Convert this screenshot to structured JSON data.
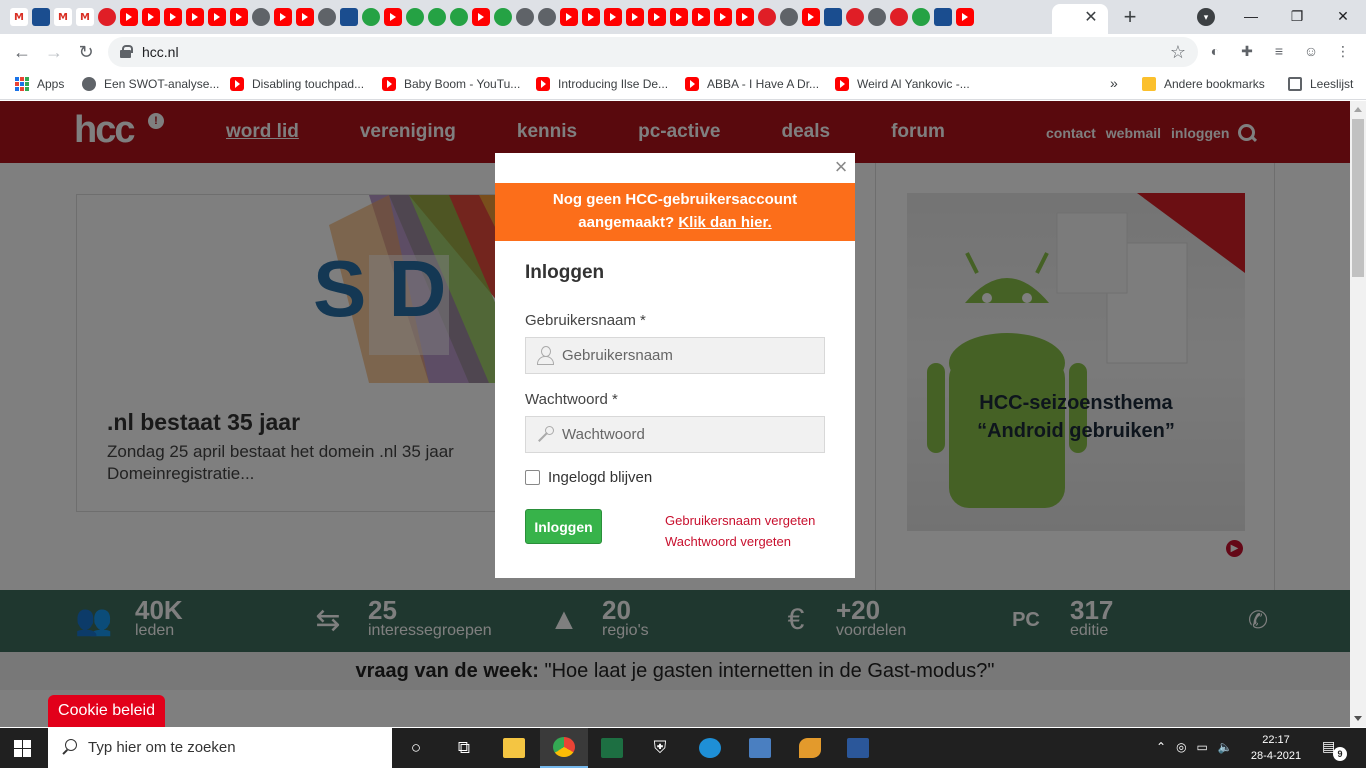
{
  "browser": {
    "url": "hcc.nl",
    "bookmarks": [
      {
        "label": "Apps",
        "icon": "apps-icon"
      },
      {
        "label": "Een SWOT-analyse...",
        "icon": "globe-icon"
      },
      {
        "label": "Disabling touchpad...",
        "icon": "youtube-icon"
      },
      {
        "label": "Baby Boom - YouTu...",
        "icon": "youtube-icon"
      },
      {
        "label": "Introducing Ilse De...",
        "icon": "youtube-icon"
      },
      {
        "label": "ABBA - I Have A Dr...",
        "icon": "youtube-icon"
      },
      {
        "label": "Weird Al Yankovic -...",
        "icon": "youtube-icon"
      }
    ],
    "bookmarks_more": "»",
    "other_bookmarks": "Andere bookmarks",
    "reading_list": "Leeslijst"
  },
  "site": {
    "logo": "hcc",
    "logo_mark": "!",
    "nav": [
      "word lid",
      "vereniging",
      "kennis",
      "pc-active",
      "deals",
      "forum"
    ],
    "side_nav": [
      "contact",
      "webmail",
      "inloggen"
    ],
    "news": {
      "image_text": "S D",
      "title": ".nl bestaat 35 jaar",
      "text": "Zondag 25 april bestaat het domein .nl 35 jaar Domeinregistratie...",
      "ghost": "Zo... ...g"
    },
    "feature": {
      "line1": "HCC-seizoensthema",
      "line2": "“Android gebruiken”"
    },
    "stats": [
      {
        "num": "40K",
        "label": "leden",
        "icon": "people-icon"
      },
      {
        "num": "25",
        "label": "interessegroepen",
        "icon": "signpost-icon"
      },
      {
        "num": "20",
        "label": "regio's",
        "icon": "netherlands-map-icon"
      },
      {
        "num": "+20",
        "label": "voordelen",
        "icon": "euro-badge-icon"
      },
      {
        "num": "317",
        "label": "editie",
        "icon": "pc-active-icon"
      }
    ],
    "question_label": "vraag van de week:",
    "question_text": "\"Hoe laat je gasten internetten in de Gast-modus?\"",
    "cookie": "Cookie beleid"
  },
  "modal": {
    "banner_line1": "Nog geen HCC-gebruikersaccount",
    "banner_line2": "aangemaakt?",
    "banner_link": "Klik dan hier.",
    "title": "Inloggen",
    "username_label": "Gebruikersnaam *",
    "username_placeholder": "Gebruikersnaam",
    "password_label": "Wachtwoord *",
    "password_placeholder": "Wachtwoord",
    "remember": "Ingelogd blijven",
    "login_button": "Inloggen",
    "forgot_username": "Gebruikersnaam vergeten",
    "forgot_password": "Wachtwoord vergeten"
  },
  "taskbar": {
    "search_placeholder": "Typ hier om te zoeken",
    "time": "22:17",
    "date": "28-4-2021",
    "notifications": "9"
  },
  "colors": {
    "header_red": "#b3121b",
    "banner_orange": "#fc6e1a",
    "login_green": "#37b34a",
    "link_red": "#c8102e",
    "stats_green": "#3e6f5e"
  }
}
